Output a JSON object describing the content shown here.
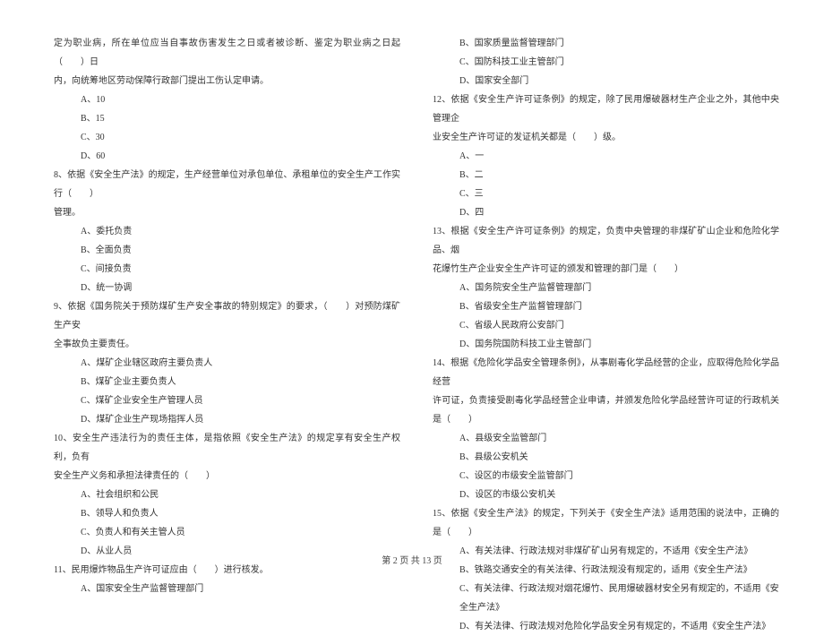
{
  "left": {
    "q7_line1": "定为职业病，所在单位应当自事故伤害发生之日或者被诊断、鉴定为职业病之日起（　　）日",
    "q7_line2": "内，向统筹地区劳动保障行政部门提出工伤认定申请。",
    "q7a": "A、10",
    "q7b": "B、15",
    "q7c": "C、30",
    "q7d": "D、60",
    "q8_line1": "8、依据《安全生产法》的规定，生产经营单位对承包单位、承租单位的安全生产工作实行（　　）",
    "q8_line2": "管理。",
    "q8a": "A、委托负责",
    "q8b": "B、全面负责",
    "q8c": "C、间接负责",
    "q8d": "D、统一协调",
    "q9_line1": "9、依据《国务院关于预防煤矿生产安全事故的特别规定》的要求，（　　）对预防煤矿生产安",
    "q9_line2": "全事故负主要责任。",
    "q9a": "A、煤矿企业辖区政府主要负责人",
    "q9b": "B、煤矿企业主要负责人",
    "q9c": "C、煤矿企业安全生产管理人员",
    "q9d": "D、煤矿企业生产现场指挥人员",
    "q10_line1": "10、安全生产违法行为的责任主体，是指依照《安全生产法》的规定享有安全生产权利，负有",
    "q10_line2": "安全生产义务和承担法律责任的（　　）",
    "q10a": "A、社会组织和公民",
    "q10b": "B、领导人和负责人",
    "q10c": "C、负责人和有关主管人员",
    "q10d": "D、从业人员",
    "q11_line1": "11、民用爆炸物品生产许可证应由（　　）进行核发。",
    "q11a": "A、国家安全生产监督管理部门"
  },
  "right": {
    "q11b": "B、国家质量监督管理部门",
    "q11c": "C、国防科技工业主管部门",
    "q11d": "D、国家安全部门",
    "q12_line1": "12、依据《安全生产许可证条例》的规定，除了民用爆破器材生产企业之外，其他中央管理企",
    "q12_line2": "业安全生产许可证的发证机关都是（　　）级。",
    "q12a": "A、一",
    "q12b": "B、二",
    "q12c": "C、三",
    "q12d": "D、四",
    "q13_line1": "13、根据《安全生产许可证条例》的规定，负责中央管理的非煤矿矿山企业和危险化学品、烟",
    "q13_line2": "花爆竹生产企业安全生产许可证的颁发和管理的部门是（　　）",
    "q13a": "A、国务院安全生产监督管理部门",
    "q13b": "B、省级安全生产监督管理部门",
    "q13c": "C、省级人民政府公安部门",
    "q13d": "D、国务院国防科技工业主管部门",
    "q14_line1": "14、根据《危险化学品安全管理条例》，从事剧毒化学品经营的企业，应取得危险化学品经营",
    "q14_line2": "许可证，负责接受剧毒化学品经营企业申请，并颁发危险化学品经营许可证的行政机关是（　　）",
    "q14a": "A、县级安全监管部门",
    "q14b": "B、县级公安机关",
    "q14c": "C、设区的市级安全监管部门",
    "q14d": "D、设区的市级公安机关",
    "q15_line1": "15、依据《安全生产法》的规定，下列关于《安全生产法》适用范围的说法中，正确的是（　　）",
    "q15a": "A、有关法律、行政法规对非煤矿矿山另有规定的，不适用《安全生产法》",
    "q15b": "B、铁路交通安全的有关法律、行政法规没有规定的，适用《安全生产法》",
    "q15c": "C、有关法律、行政法规对烟花爆竹、民用爆破器材安全另有规定的，不适用《安全生产法》",
    "q15d": "D、有关法律、行政法规对危险化学品安全另有规定的，不适用《安全生产法》"
  },
  "footer": "第 2 页 共 13 页"
}
